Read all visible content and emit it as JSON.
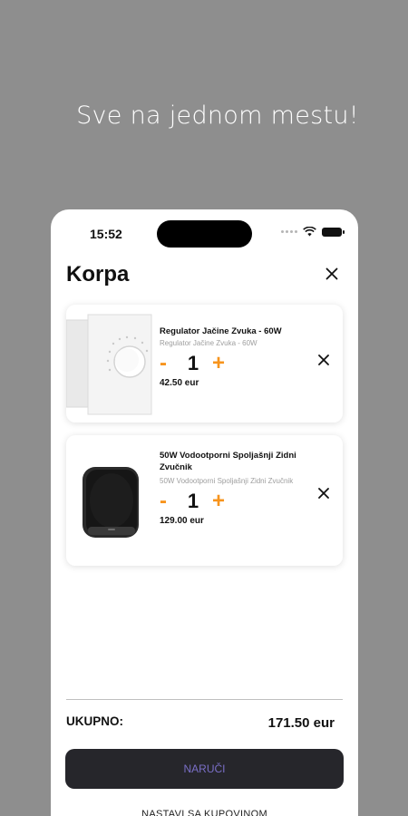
{
  "headline": "Sve na jednom mestu!",
  "status": {
    "time": "15:52"
  },
  "cart": {
    "title": "Korpa",
    "items": [
      {
        "name": "Regulator Jačine Zvuka - 60W",
        "description": "Regulator Jačine Zvuka - 60W",
        "minus": "-",
        "quantity": "1",
        "plus": "+",
        "price": "42.50 eur",
        "image": "volume-regulator"
      },
      {
        "name": "50W Vodootporni Spoljašnji Zidni Zvučnik",
        "description": "50W Vodootporni Spoljašnji Zidni Zvučnik",
        "minus": "-",
        "quantity": "1",
        "plus": "+",
        "price": "129.00 eur",
        "image": "wall-speaker"
      }
    ],
    "total_label": "UKUPNO:",
    "total_value": "171.50 eur",
    "order_button": "NARUČI",
    "continue_link": "NASTAVI SA KUPOVINOM"
  },
  "colors": {
    "background": "#8e8e8e",
    "accent": "#f7941d",
    "button": "#26262b",
    "button_text": "#7a6fc7"
  }
}
